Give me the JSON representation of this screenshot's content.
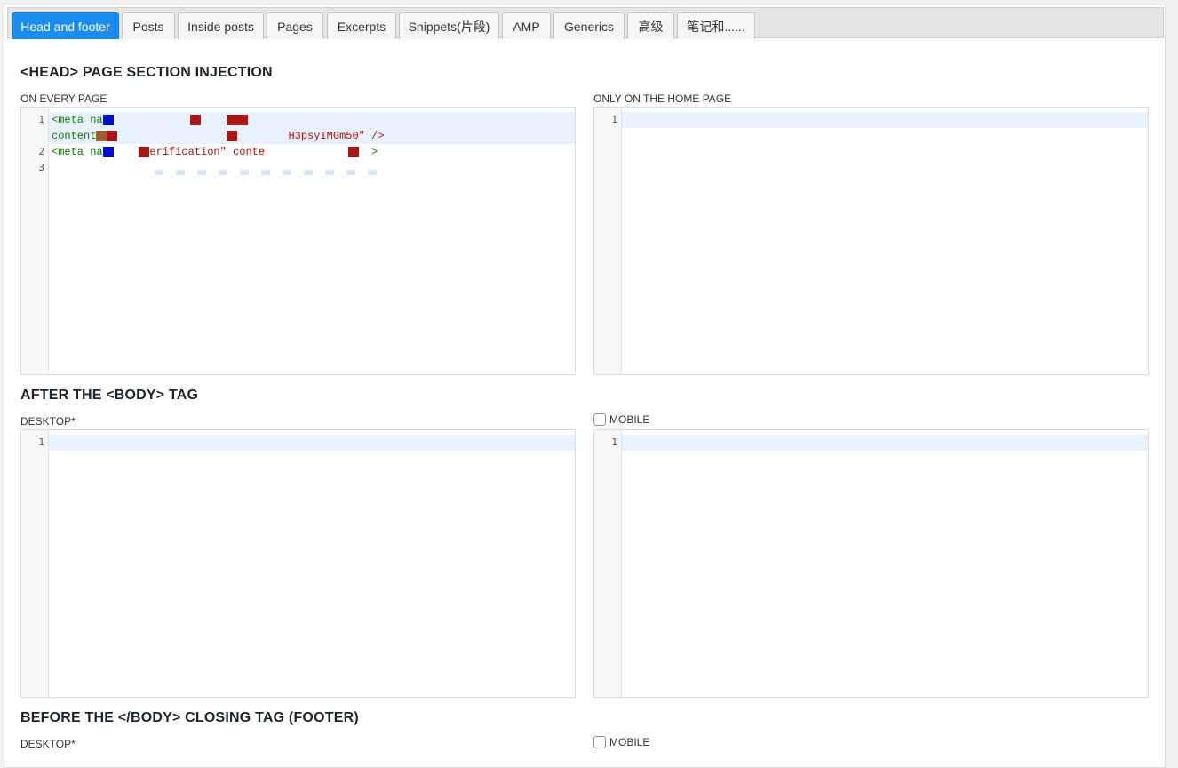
{
  "tabs": [
    {
      "label": "Head and footer",
      "active": true
    },
    {
      "label": "Posts"
    },
    {
      "label": "Inside posts"
    },
    {
      "label": "Pages"
    },
    {
      "label": "Excerpts"
    },
    {
      "label": "Snippets(片段)"
    },
    {
      "label": "AMP"
    },
    {
      "label": "Generics"
    },
    {
      "label": "高级"
    },
    {
      "label": "笔记和......"
    }
  ],
  "head_section": {
    "title": "<HEAD> PAGE SECTION INJECTION",
    "every_page_label": "ON EVERY PAGE",
    "home_page_label": "ONLY ON THE HOME PAGE",
    "every_page_code": {
      "line1_start": "<meta na",
      "line1_tail": "content",
      "line1_end": "H3psyIMGm50\" />",
      "line2_start": "<meta na",
      "line2_mid": "erification\" conte",
      "line2_end": ">"
    },
    "home_page_lines": [
      "1"
    ],
    "every_page_lines": [
      "1",
      "2",
      "3"
    ]
  },
  "body_section": {
    "title": "AFTER THE <BODY> TAG",
    "desktop_label": "DESKTOP*",
    "mobile_label": "MOBILE",
    "lines": [
      "1"
    ]
  },
  "footer_section": {
    "title": "BEFORE THE </BODY> CLOSING TAG (FOOTER)",
    "desktop_label": "DESKTOP*",
    "mobile_label": "MOBILE"
  },
  "colors": {
    "accent": "#1a8ef0",
    "active_line": "#e8f2ff"
  }
}
